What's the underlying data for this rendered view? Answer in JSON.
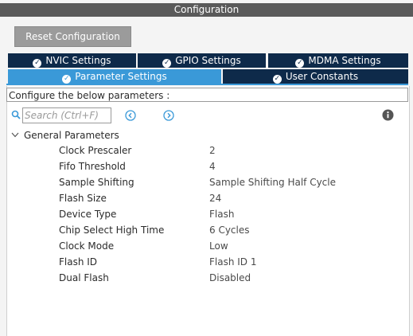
{
  "window": {
    "title": "Configuration"
  },
  "toolbar": {
    "reset_label": "Reset Configuration"
  },
  "tabs": [
    {
      "label": "NVIC Settings",
      "active": false
    },
    {
      "label": "GPIO Settings",
      "active": false
    },
    {
      "label": "MDMA Settings",
      "active": false
    },
    {
      "label": "Parameter Settings",
      "active": true
    },
    {
      "label": "User Constants",
      "active": false
    }
  ],
  "description": "Configure the below parameters :",
  "search": {
    "placeholder": "Search (Ctrl+F)",
    "value": ""
  },
  "icons": {
    "search": "search-icon",
    "prev": "arrow-left-circle-icon",
    "next": "arrow-right-circle-icon",
    "info": "info-icon",
    "check": "check-circle-icon",
    "collapse": "chevron-down-icon"
  },
  "colors": {
    "title_bar": "#5a5a5a",
    "tab_inactive": "#0e2a4a",
    "tab_active": "#3a99d8",
    "reset_button": "#9b9b9b",
    "accent_icons": "#3a99d8"
  },
  "group": {
    "label": "General Parameters",
    "expanded": true,
    "params": [
      {
        "name": "Clock Prescaler",
        "value": "2"
      },
      {
        "name": "Fifo Threshold",
        "value": "4"
      },
      {
        "name": "Sample Shifting",
        "value": "Sample Shifting Half Cycle"
      },
      {
        "name": "Flash Size",
        "value": "24"
      },
      {
        "name": "Device Type",
        "value": "Flash"
      },
      {
        "name": "Chip Select High Time",
        "value": "6 Cycles"
      },
      {
        "name": "Clock Mode",
        "value": "Low"
      },
      {
        "name": "Flash ID",
        "value": "Flash ID 1"
      },
      {
        "name": "Dual Flash",
        "value": "Disabled"
      }
    ]
  }
}
